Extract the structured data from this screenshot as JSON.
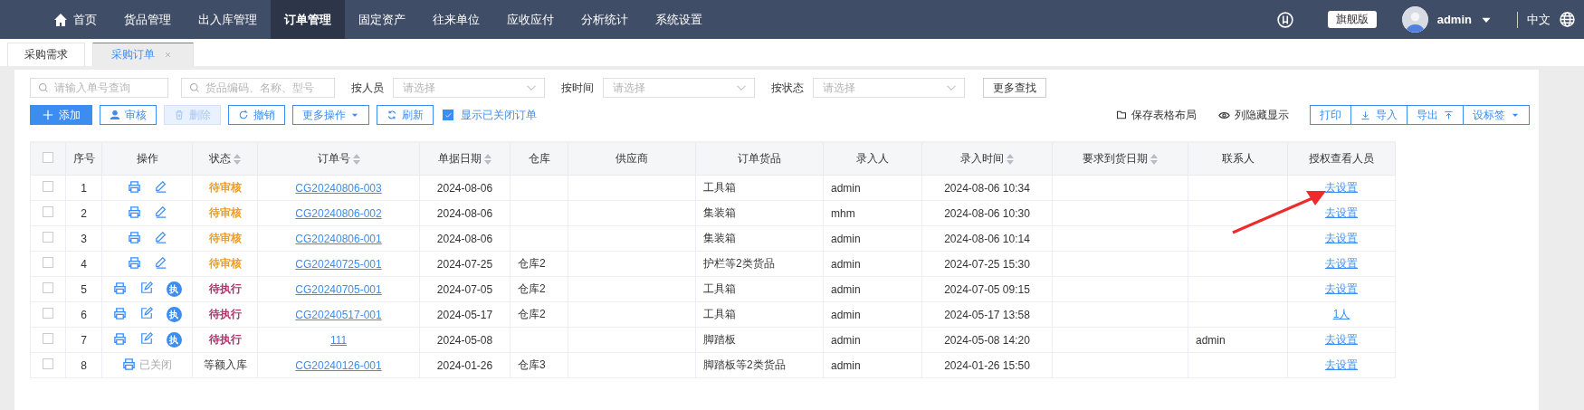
{
  "nav": {
    "home": "首页",
    "items": [
      {
        "label": "货品管理",
        "selected": false
      },
      {
        "label": "出入库管理",
        "selected": false
      },
      {
        "label": "订单管理",
        "selected": true
      },
      {
        "label": "固定资产",
        "selected": false
      },
      {
        "label": "往来单位",
        "selected": false
      },
      {
        "label": "应收应付",
        "selected": false
      },
      {
        "label": "分析统计",
        "selected": false
      },
      {
        "label": "系统设置",
        "selected": false
      }
    ],
    "edition": "旗舰版",
    "user": "admin",
    "language": "中文"
  },
  "page_tabs": [
    {
      "label": "采购需求",
      "selected": false
    },
    {
      "label": "采购订单",
      "selected": true
    }
  ],
  "filters": {
    "search": [
      {
        "placeholder": "请输入单号查询"
      },
      {
        "placeholder": "货品编码、名称、型号"
      }
    ],
    "selects": [
      {
        "label": "按人员",
        "placeholder": "请选择"
      },
      {
        "label": "按时间",
        "placeholder": "请选择"
      },
      {
        "label": "按状态",
        "placeholder": "请选择"
      }
    ],
    "more": "更多查找"
  },
  "toolbar": {
    "buttons": [
      {
        "label": "添加",
        "kind": "primary",
        "disabled": false
      },
      {
        "label": "审核",
        "kind": "default",
        "disabled": false
      },
      {
        "label": "删除",
        "kind": "default",
        "disabled": true
      },
      {
        "label": "撤销",
        "kind": "default",
        "disabled": false
      },
      {
        "label": "更多操作",
        "kind": "default",
        "disabled": false
      },
      {
        "label": "刷新",
        "kind": "default",
        "disabled": false
      }
    ],
    "show_closed": {
      "label": "显示已关闭订单",
      "checked": true
    },
    "links": [
      {
        "label": "保存表格布局"
      },
      {
        "label": "列隐藏显示"
      }
    ],
    "group": [
      {
        "label": "打印"
      },
      {
        "label": "导入"
      },
      {
        "label": "导出"
      },
      {
        "label": "设标签"
      }
    ]
  },
  "table": {
    "all_checked": false,
    "columns": [
      {
        "label": "序号",
        "sortable": false
      },
      {
        "label": "操作",
        "sortable": false
      },
      {
        "label": "状态",
        "sortable": true
      },
      {
        "label": "订单号",
        "sortable": true
      },
      {
        "label": "单据日期",
        "sortable": true
      },
      {
        "label": "仓库",
        "sortable": false
      },
      {
        "label": "供应商",
        "sortable": false
      },
      {
        "label": "订单货品",
        "sortable": false
      },
      {
        "label": "录入人",
        "sortable": false
      },
      {
        "label": "录入时间",
        "sortable": true
      },
      {
        "label": "要求到货日期",
        "sortable": true
      },
      {
        "label": "联系人",
        "sortable": false
      },
      {
        "label": "授权查看人员",
        "sortable": false
      }
    ],
    "rows": [
      {
        "checked": false,
        "index": "1",
        "kind": "review",
        "status": {
          "text": "待审核",
          "kind": "review"
        },
        "order_no": "CG20240806-003",
        "date": "2024-08-06",
        "warehouse": "",
        "goods": "工具箱",
        "creator": "admin",
        "created": "2024-08-06 10:34",
        "contact": "",
        "auth": "去设置"
      },
      {
        "checked": false,
        "index": "2",
        "kind": "review",
        "status": {
          "text": "待审核",
          "kind": "review"
        },
        "order_no": "CG20240806-002",
        "date": "2024-08-06",
        "warehouse": "",
        "goods": "集装箱",
        "creator": "mhm",
        "created": "2024-08-06 10:30",
        "contact": "",
        "auth": "去设置"
      },
      {
        "checked": false,
        "index": "3",
        "kind": "review",
        "status": {
          "text": "待审核",
          "kind": "review"
        },
        "order_no": "CG20240806-001",
        "date": "2024-08-06",
        "warehouse": "",
        "goods": "集装箱",
        "creator": "admin",
        "created": "2024-08-06 10:14",
        "contact": "",
        "auth": "去设置"
      },
      {
        "checked": false,
        "index": "4",
        "kind": "review",
        "status": {
          "text": "待审核",
          "kind": "review"
        },
        "order_no": "CG20240725-001",
        "date": "2024-07-25",
        "warehouse": "仓库2",
        "goods": "护栏等2类货品",
        "creator": "admin",
        "created": "2024-07-25 15:30",
        "contact": "",
        "auth": "去设置"
      },
      {
        "checked": false,
        "index": "5",
        "kind": "execute",
        "exec": "执",
        "status": {
          "text": "待执行",
          "kind": "execute"
        },
        "order_no": "CG20240705-001",
        "date": "2024-07-05",
        "warehouse": "仓库2",
        "goods": "工具箱",
        "creator": "admin",
        "created": "2024-07-05 09:15",
        "contact": "",
        "auth": "去设置"
      },
      {
        "checked": false,
        "index": "6",
        "kind": "execute",
        "exec": "执",
        "status": {
          "text": "待执行",
          "kind": "execute"
        },
        "order_no": "CG20240517-001",
        "date": "2024-05-17",
        "warehouse": "仓库2",
        "goods": "工具箱",
        "creator": "admin",
        "created": "2024-05-17 13:58",
        "contact": "",
        "auth": "1人"
      },
      {
        "checked": false,
        "index": "7",
        "kind": "execute",
        "exec": "执",
        "status": {
          "text": "待执行",
          "kind": "execute"
        },
        "order_no": "111",
        "date": "2024-05-08",
        "warehouse": "",
        "goods": "脚踏板",
        "creator": "admin",
        "created": "2024-05-08 14:20",
        "contact": "admin",
        "auth": "去设置"
      },
      {
        "checked": false,
        "index": "8",
        "kind": "closed",
        "closed": "已关闭",
        "status": {
          "text": "等额入库",
          "kind": "plain"
        },
        "order_no": "CG20240126-001",
        "date": "2024-01-26",
        "warehouse": "仓库3",
        "goods": "脚踏板等2类货品",
        "creator": "admin",
        "created": "2024-01-26 15:50",
        "contact": "",
        "auth": "去设置"
      }
    ]
  },
  "annotation": {
    "kind": "arrow"
  }
}
